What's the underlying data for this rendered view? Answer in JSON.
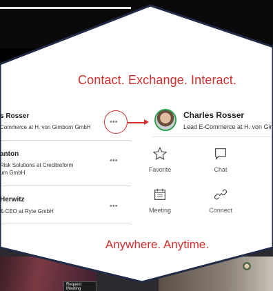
{
  "headline": "Contact. Exchange. Interact.",
  "tagline": "Anywhere. Anytime.",
  "contacts": [
    {
      "name": "s Rosser",
      "sub1": "Commerce at H. von Gimborn GmbH",
      "sub2": ""
    },
    {
      "name": "anton",
      "sub1": "Risk Solutions at Creditreform",
      "sub2": "um GmbH"
    },
    {
      "name": "Herwitz",
      "sub1": "& CEO at Ryte GmbH",
      "sub2": ""
    }
  ],
  "more_dots": "•••",
  "profile": {
    "name": "Charles Rosser",
    "role": "Lead E-Commerce at H. von Gim"
  },
  "actions": {
    "favorite": "Favorite",
    "chat": "Chat",
    "meeting": "Meeting",
    "connect": "Connect"
  },
  "bottom_badge": "Request Meeting",
  "colors": {
    "accent": "#d42e2e",
    "online": "#2e9e4f"
  }
}
